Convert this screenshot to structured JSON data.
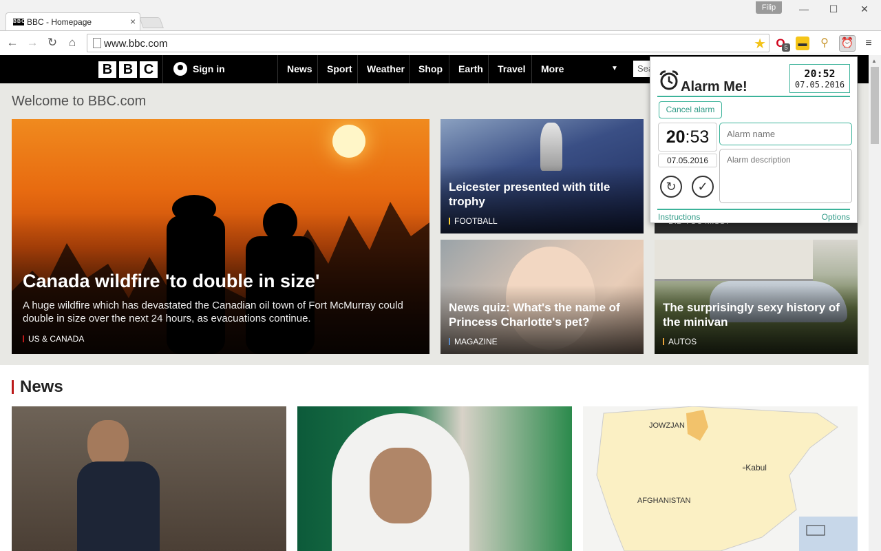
{
  "browser": {
    "tab_title": "BBC - Homepage",
    "tab_favicon": "BBC",
    "profile_name": "Filip",
    "url": "www.bbc.com",
    "extension_badge": "5"
  },
  "bbc": {
    "signin": "Sign in",
    "nav": [
      "News",
      "Sport",
      "Weather",
      "Shop",
      "Earth",
      "Travel",
      "More"
    ],
    "search_placeholder": "Sea",
    "welcome": "Welcome to BBC.com",
    "hero": {
      "headline": "Canada wildfire 'to double in size'",
      "summary": "A huge wildfire which has devastated the Canadian oil town of Fort McMurray could double in size over the next 24 hours, as evacuations continue.",
      "tag": "US & CANADA",
      "tag_color": "#bb1919"
    },
    "stories": [
      {
        "headline": "Leicester presented with title trophy",
        "tag": "FOOTBALL",
        "tag_color": "#ffd230"
      },
      {
        "headline": "News quiz: What's the name of Princess Charlotte's pet?",
        "tag": "MAGAZINE",
        "tag_color": "#5a8bc9"
      },
      {
        "headline": "The surprisingly sexy history of the minivan",
        "tag": "AUTOS",
        "tag_color": "#e8a33a"
      }
    ],
    "partial_tag": "DID YOU MISS?",
    "news_section_title": "News",
    "map_labels": {
      "jowzjan": "JOWZJAN",
      "kabul": "Kabul",
      "afghanistan": "AFGHANISTAN"
    }
  },
  "alarm_popup": {
    "app_name": "Alarm Me!",
    "current_time": "20:52",
    "current_date": "07.05.2016",
    "cancel_label": "Cancel alarm",
    "alarm_hour": "20",
    "alarm_minute": "53",
    "alarm_date": "07.05.2016",
    "name_placeholder": "Alarm name",
    "description_placeholder": "Alarm description",
    "instructions_link": "Instructions",
    "options_link": "Options",
    "accent_color": "#3cb39a"
  }
}
